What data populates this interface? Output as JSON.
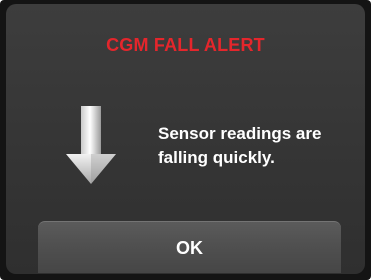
{
  "alert": {
    "title": "CGM FALL ALERT",
    "message_lines": [
      "Sensor readings are",
      "falling quickly."
    ],
    "icon": "down-arrow-icon",
    "title_color": "#e4262c"
  },
  "buttons": {
    "ok_label": "OK"
  }
}
